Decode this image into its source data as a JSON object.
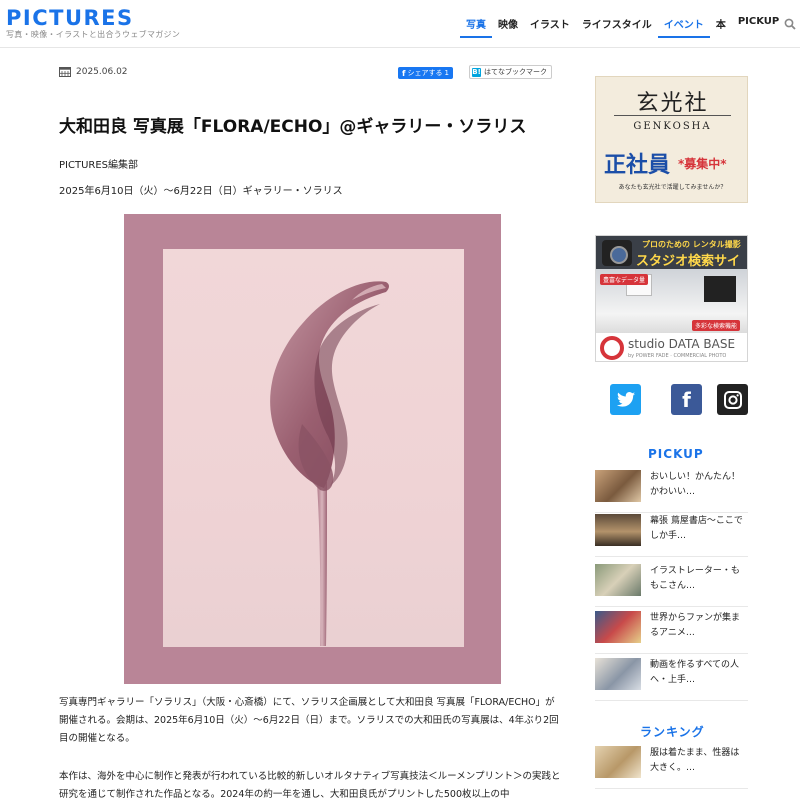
{
  "header": {
    "logo": "PICTURES",
    "tagline": "写真・映像・イラストと出合うウェブマガジン",
    "nav": [
      {
        "label": "写真",
        "active": true
      },
      {
        "label": "映像",
        "active": false
      },
      {
        "label": "イラスト",
        "active": false
      },
      {
        "label": "ライフスタイル",
        "active": false
      },
      {
        "label": "イベント",
        "active": true
      },
      {
        "label": "本",
        "active": false
      },
      {
        "label": "PICKUP",
        "active": false
      }
    ]
  },
  "article": {
    "date": "2025.06.02",
    "share_fb": "シェアする",
    "share_fb_count": "1",
    "share_hatena": "はてなブックマーク",
    "title": "大和田良 写真展「FLORA/ECHO」@ギャラリー・ソラリス",
    "author": "PICTURES編集部",
    "period": "2025年6月10日（火）〜6月22日（日）ギャラリー・ソラリス",
    "paragraph1": "写真専門ギャラリー「ソラリス」（大阪・心斎橋）にて、ソラリス企画展として大和田良 写真展「FLORA/ECHO」が開催される。会期は、2025年6月10日（火）〜6月22日（日）まで。ソラリスでの大和田氏の写真展は、4年ぶり2回目の開催となる。",
    "paragraph2": "本作は、海外を中心に制作と発表が行われている比較的新しいオルタナティブ写真技法＜ルーメンプリント＞の実践と研究を通じて制作された作品となる。2024年の約一年を通し、大和田良氏がプリントした500枚以上の中"
  },
  "sidebar": {
    "ad1": {
      "kanji": "玄光社",
      "latin": "GENKOSHA",
      "big": "正社員",
      "recruit": "*募集中*",
      "sub": "あなたも玄光社で活躍してみませんか？"
    },
    "ad2": {
      "line1": "プロのための レンタル撮影",
      "line2": "スタジオ検索サイト",
      "badge1": "豊富なデータ量",
      "badge2": "多彩な検索機能",
      "brand": "studio DATA BASE",
      "brand_sub": "by POWER FADE · COMMERCIAL PHOTO"
    },
    "pickup_heading": "PICKUP",
    "pickup": [
      {
        "text": "おいしい！かんたん！かわいい…"
      },
      {
        "text": "幕張 蔦屋書店〜ここでしか手…"
      },
      {
        "text": "イラストレーター・ももこさん…"
      },
      {
        "text": "世界からファンが集まるアニメ…"
      },
      {
        "text": "動画を作るすべての人へ・上手…"
      }
    ],
    "ranking_heading": "ランキング",
    "ranking": [
      {
        "text": "服は着たまま、性器は大きく。…"
      }
    ]
  },
  "colors": {
    "accent": "#1a73e8",
    "photo_frame": "#b98597",
    "photo_paper": "#f1d7d8"
  }
}
